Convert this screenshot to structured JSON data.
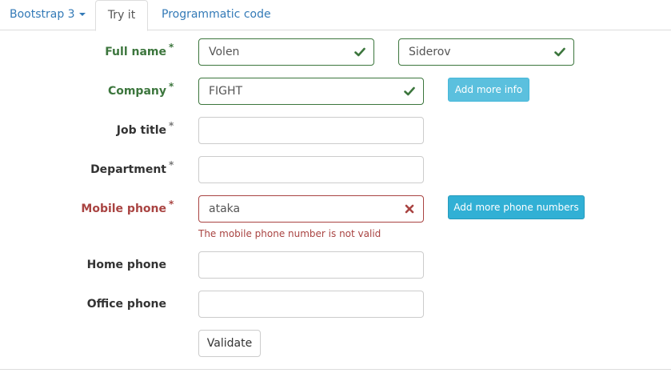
{
  "tabs": {
    "bootstrap": "Bootstrap 3",
    "try_it": "Try it",
    "programmatic": "Programmatic code"
  },
  "form": {
    "full_name": {
      "label": "Full name",
      "first": "Volen",
      "last": "Siderov",
      "state": "success"
    },
    "company": {
      "label": "Company",
      "value": "FIGHT",
      "state": "success",
      "button": "Add more info"
    },
    "job_title": {
      "label": "Job title",
      "value": ""
    },
    "department": {
      "label": "Department",
      "value": ""
    },
    "mobile_phone": {
      "label": "Mobile phone",
      "value": "ataka",
      "state": "error",
      "error_message": "The mobile phone number is not valid",
      "button": "Add more phone numbers"
    },
    "home_phone": {
      "label": "Home phone",
      "value": ""
    },
    "office_phone": {
      "label": "Office phone",
      "value": ""
    },
    "required_marker": "*",
    "validate_button": "Validate"
  },
  "colors": {
    "success": "#3c763d",
    "error": "#a94442",
    "link": "#337ab7",
    "info": "#5bc0de"
  },
  "icons": {
    "valid": "check-icon",
    "invalid": "x-icon",
    "dropdown": "caret-down-icon"
  }
}
